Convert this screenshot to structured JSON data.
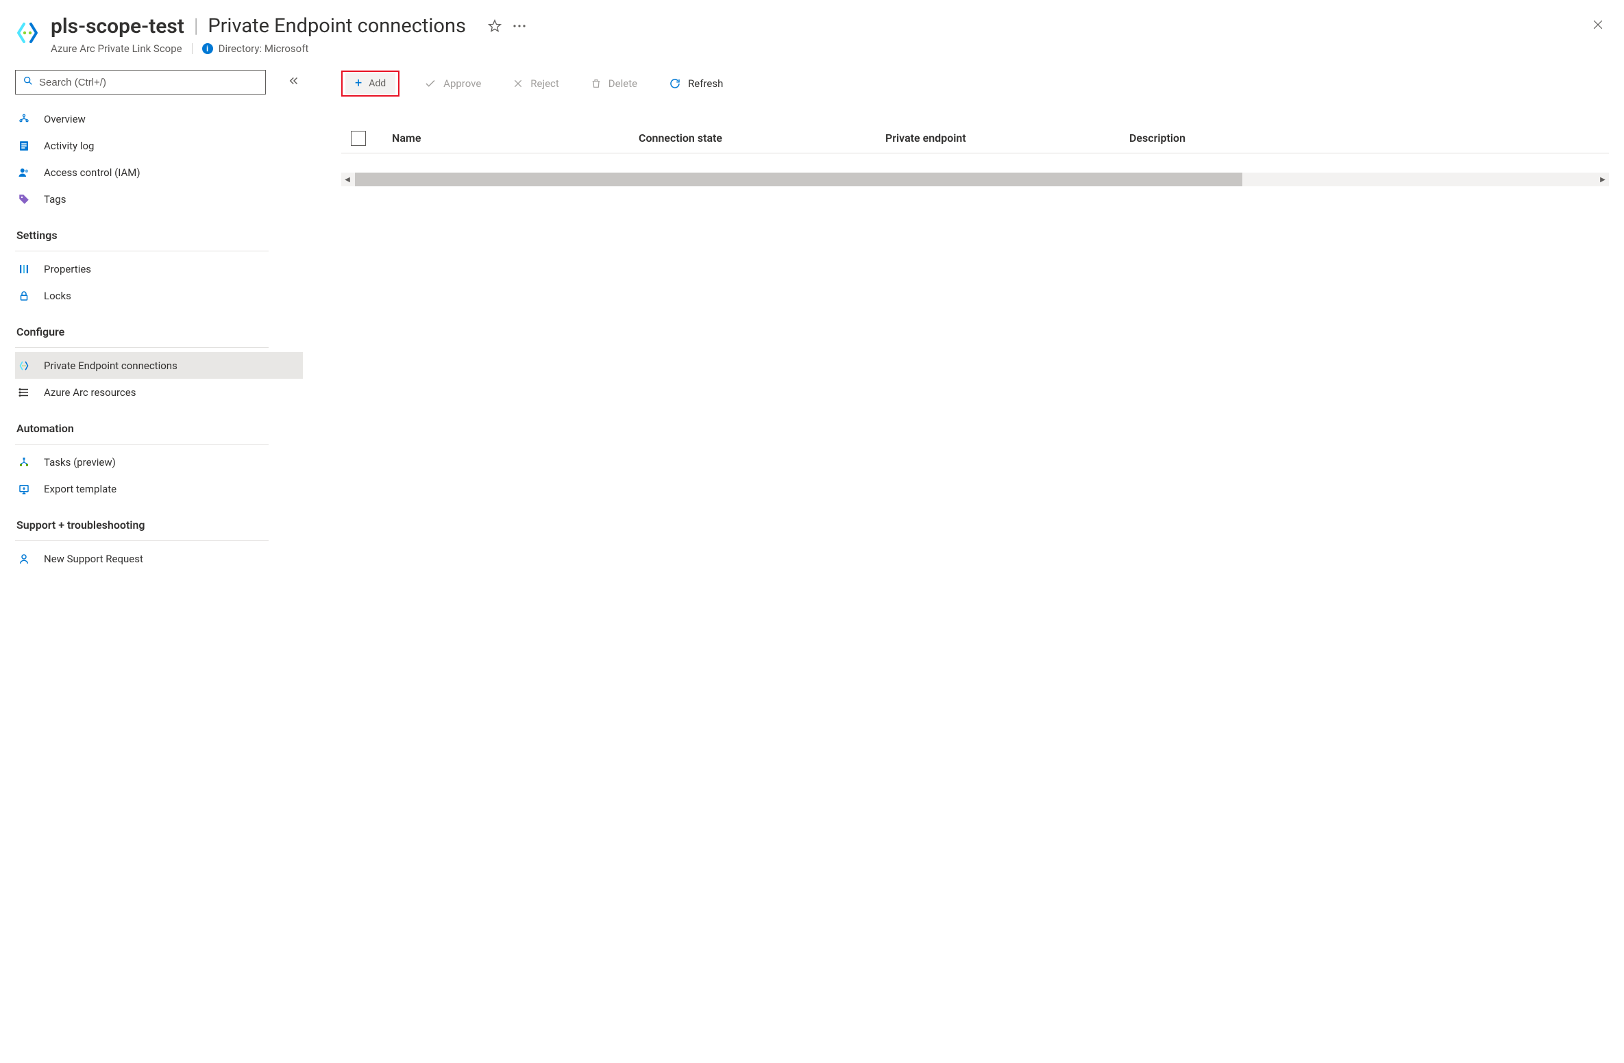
{
  "header": {
    "resource_name": "pls-scope-test",
    "page_title": "Private Endpoint connections",
    "resource_type": "Azure Arc Private Link Scope",
    "directory_label": "Directory: Microsoft"
  },
  "sidebar": {
    "search_placeholder": "Search (Ctrl+/)",
    "top": [
      {
        "label": "Overview"
      },
      {
        "label": "Activity log"
      },
      {
        "label": "Access control (IAM)"
      },
      {
        "label": "Tags"
      }
    ],
    "groups": [
      {
        "title": "Settings",
        "items": [
          {
            "label": "Properties"
          },
          {
            "label": "Locks"
          }
        ]
      },
      {
        "title": "Configure",
        "items": [
          {
            "label": "Private Endpoint connections",
            "selected": true
          },
          {
            "label": "Azure Arc resources"
          }
        ]
      },
      {
        "title": "Automation",
        "items": [
          {
            "label": "Tasks (preview)"
          },
          {
            "label": "Export template"
          }
        ]
      },
      {
        "title": "Support + troubleshooting",
        "items": [
          {
            "label": "New Support Request"
          }
        ]
      }
    ]
  },
  "toolbar": {
    "add": "Add",
    "approve": "Approve",
    "reject": "Reject",
    "delete": "Delete",
    "refresh": "Refresh"
  },
  "table": {
    "columns": {
      "name": "Name",
      "state": "Connection state",
      "endpoint": "Private endpoint",
      "description": "Description"
    }
  }
}
